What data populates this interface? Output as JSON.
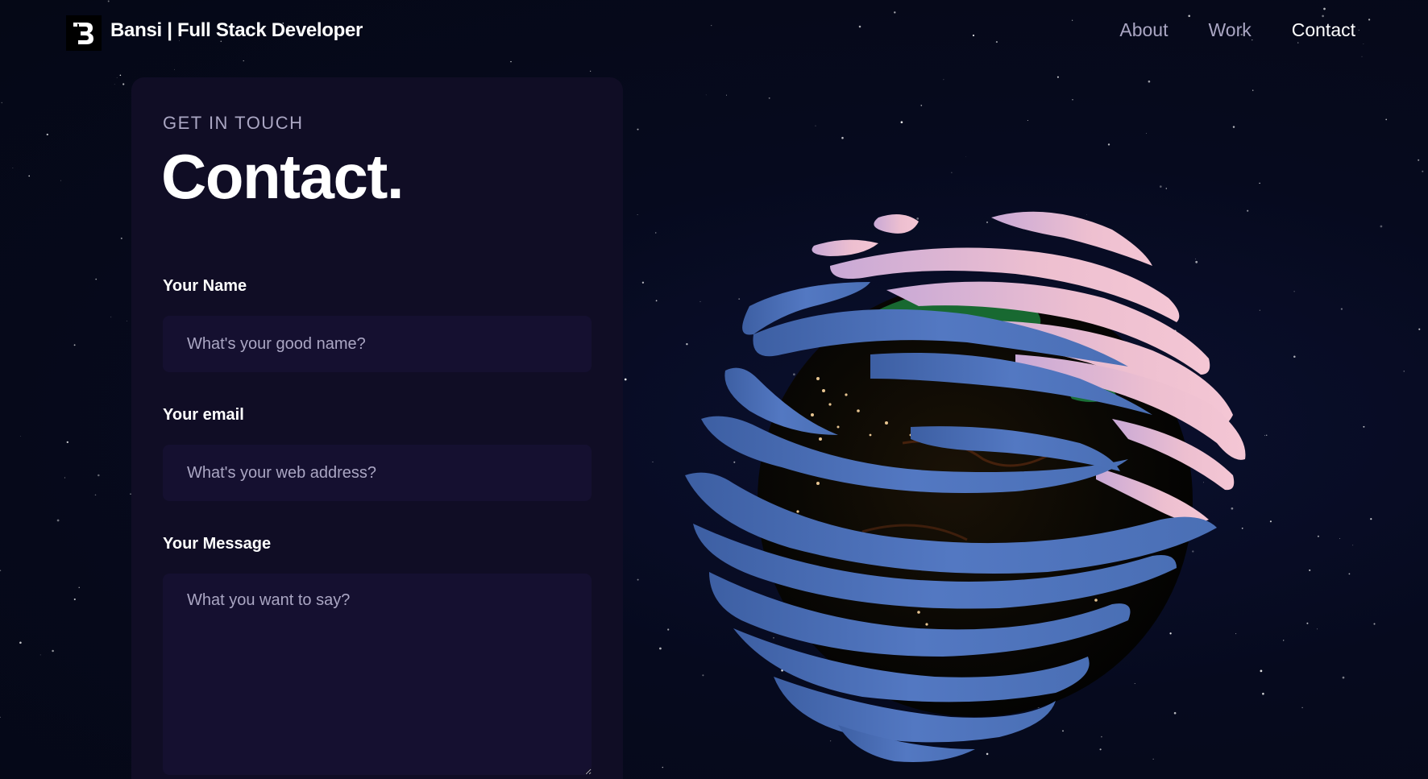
{
  "navbar": {
    "brand": "Bansi  | Full Stack Developer",
    "logo_letter": "B",
    "links": [
      "About",
      "Work",
      "Contact"
    ],
    "active_link": "Contact"
  },
  "contact": {
    "subtitle": "GET IN TOUCH",
    "title": "Contact.",
    "fields": {
      "name": {
        "label": "Your Name",
        "placeholder": "What's your good name?",
        "value": ""
      },
      "email": {
        "label": "Your email",
        "placeholder": "What's your web address?",
        "value": ""
      },
      "message": {
        "label": "Your Message",
        "placeholder": "What you want to say?",
        "value": ""
      }
    }
  },
  "scene": {
    "object": "earth-globe",
    "background": "starfield"
  },
  "colors": {
    "background": "#050816",
    "card": "#100d25",
    "input": "#151030",
    "secondary_text": "#aaa6c3",
    "primary_text": "#ffffff",
    "band_blue": "#4a6fb5",
    "band_pink": "#e8b4c8"
  }
}
